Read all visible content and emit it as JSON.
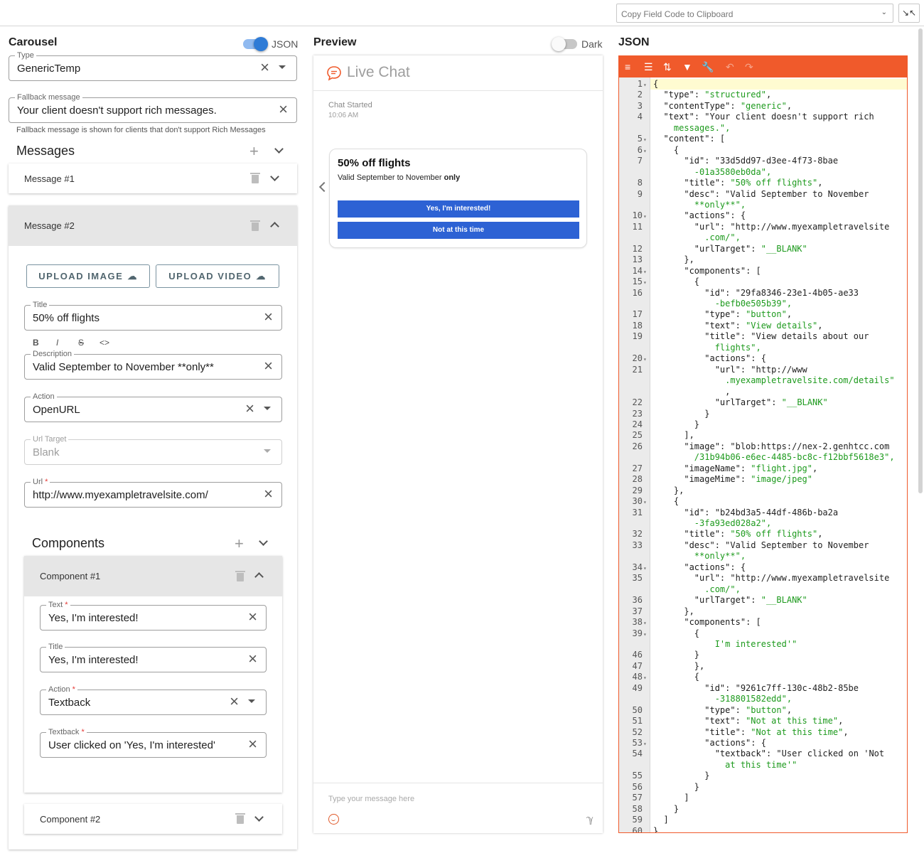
{
  "topbar": {
    "copy_select": "Copy Field Code to Clipboard",
    "shrink_icon": "minimize-icon"
  },
  "carousel": {
    "title": "Carousel",
    "json_toggle_label": "JSON",
    "json_toggle_on": true,
    "type": {
      "label": "Type",
      "value": "GenericTemp"
    },
    "fallback": {
      "label": "Fallback message",
      "value": "Your client doesn't support rich messages.",
      "helper": "Fallback message is shown for clients that don't support Rich Messages"
    },
    "messages_title": "Messages",
    "message1": {
      "label": "Message #1"
    },
    "message2": {
      "label": "Message #2",
      "upload_image": "UPLOAD IMAGE",
      "upload_video": "UPLOAD VIDEO",
      "title": {
        "label": "Title",
        "value": "50% off flights"
      },
      "format_buttons": [
        "B",
        "I",
        "S",
        "<>"
      ],
      "description": {
        "label": "Description",
        "value": "Valid September to November **only**"
      },
      "action": {
        "label": "Action",
        "value": "OpenURL"
      },
      "url_target": {
        "label": "Url Target",
        "value": "Blank"
      },
      "url": {
        "label": "Url",
        "value": "http://www.myexampletravelsite.com/"
      },
      "components_title": "Components",
      "component1": {
        "label": "Component #1",
        "text": {
          "label": "Text",
          "value": "Yes, I'm interested!"
        },
        "title": {
          "label": "Title",
          "value": "Yes, I'm interested!"
        },
        "action": {
          "label": "Action",
          "value": "Textback"
        },
        "textback": {
          "label": "Textback",
          "value": "User clicked on 'Yes, I'm interested'"
        }
      },
      "component2": {
        "label": "Component #2"
      }
    }
  },
  "preview": {
    "title": "Preview",
    "dark_label": "Dark",
    "dark_on": false,
    "chat_title": "Live Chat",
    "chat_started": "Chat Started",
    "chat_time": "10:06 AM",
    "card_title": "50% off flights",
    "card_desc_pre": "Valid September to November ",
    "card_desc_bold": "only",
    "button1": "Yes, I'm interested!",
    "button2": "Not at this time",
    "input_placeholder": "Type your message here"
  },
  "json_editor": {
    "title": "JSON",
    "lines": [
      {
        "n": "1",
        "f": true,
        "c": "{"
      },
      {
        "n": "2",
        "c": "  \"type\": \"structured\","
      },
      {
        "n": "3",
        "c": "  \"contentType\": \"generic\","
      },
      {
        "n": "4",
        "c": "  \"text\": \"Your client doesn't support rich"
      },
      {
        "n": "",
        "c": "    messages.\","
      },
      {
        "n": "5",
        "f": true,
        "c": "  \"content\": ["
      },
      {
        "n": "6",
        "f": true,
        "c": "    {"
      },
      {
        "n": "7",
        "c": "      \"id\": \"33d5dd97-d3ee-4f73-8bae"
      },
      {
        "n": "",
        "c": "        -01a3580eb0da\","
      },
      {
        "n": "8",
        "c": "      \"title\": \"50% off flights\","
      },
      {
        "n": "9",
        "c": "      \"desc\": \"Valid September to November"
      },
      {
        "n": "",
        "c": "        **only**\","
      },
      {
        "n": "10",
        "f": true,
        "c": "      \"actions\": {"
      },
      {
        "n": "11",
        "c": "        \"url\": \"http://www.myexampletravelsite"
      },
      {
        "n": "",
        "c": "          .com/\","
      },
      {
        "n": "12",
        "c": "        \"urlTarget\": \"__BLANK\""
      },
      {
        "n": "13",
        "c": "      },"
      },
      {
        "n": "14",
        "f": true,
        "c": "      \"components\": ["
      },
      {
        "n": "15",
        "f": true,
        "c": "        {"
      },
      {
        "n": "16",
        "c": "          \"id\": \"29fa8346-23e1-4b05-ae33"
      },
      {
        "n": "",
        "c": "            -befb0e505b39\","
      },
      {
        "n": "17",
        "c": "          \"type\": \"button\","
      },
      {
        "n": "18",
        "c": "          \"text\": \"View details\","
      },
      {
        "n": "19",
        "c": "          \"title\": \"View details about our"
      },
      {
        "n": "",
        "c": "            flights\","
      },
      {
        "n": "20",
        "f": true,
        "c": "          \"actions\": {"
      },
      {
        "n": "21",
        "c": "            \"url\": \"http://www"
      },
      {
        "n": "",
        "c": "              .myexampletravelsite.com/details\""
      },
      {
        "n": "",
        "c": "              ,"
      },
      {
        "n": "22",
        "c": "            \"urlTarget\": \"__BLANK\""
      },
      {
        "n": "23",
        "c": "          }"
      },
      {
        "n": "24",
        "c": "        }"
      },
      {
        "n": "25",
        "c": "      ],"
      },
      {
        "n": "26",
        "c": "      \"image\": \"blob:https://nex-2.genhtcc.com"
      },
      {
        "n": "",
        "c": "        /31b94b06-e6ec-4485-bc8c-f12bbf5618e3\","
      },
      {
        "n": "27",
        "c": "      \"imageName\": \"flight.jpg\","
      },
      {
        "n": "28",
        "c": "      \"imageMime\": \"image/jpeg\""
      },
      {
        "n": "29",
        "c": "    },"
      },
      {
        "n": "30",
        "f": true,
        "c": "    {"
      },
      {
        "n": "31",
        "c": "      \"id\": \"b24bd3a5-44df-486b-ba2a"
      },
      {
        "n": "",
        "c": "        -3fa93ed028a2\","
      },
      {
        "n": "32",
        "c": "      \"title\": \"50% off flights\","
      },
      {
        "n": "33",
        "c": "      \"desc\": \"Valid September to November"
      },
      {
        "n": "",
        "c": "        **only**\","
      },
      {
        "n": "34",
        "f": true,
        "c": "      \"actions\": {"
      },
      {
        "n": "35",
        "c": "        \"url\": \"http://www.myexampletravelsite"
      },
      {
        "n": "",
        "c": "          .com/\","
      },
      {
        "n": "36",
        "c": "        \"urlTarget\": \"__BLANK\""
      },
      {
        "n": "37",
        "c": "      },"
      },
      {
        "n": "38",
        "f": true,
        "c": "      \"components\": ["
      },
      {
        "n": "39",
        "f": true,
        "c": "        {"
      },
      {
        "n": "",
        "c": "            I'm interested'\""
      },
      {
        "n": "46",
        "c": "        }"
      },
      {
        "n": "47",
        "c": "        },"
      },
      {
        "n": "48",
        "f": true,
        "c": "        {"
      },
      {
        "n": "49",
        "c": "          \"id\": \"9261c7ff-130c-48b2-85be"
      },
      {
        "n": "",
        "c": "            -318801582edd\","
      },
      {
        "n": "50",
        "c": "          \"type\": \"button\","
      },
      {
        "n": "51",
        "c": "          \"text\": \"Not at this time\","
      },
      {
        "n": "52",
        "c": "          \"title\": \"Not at this time\","
      },
      {
        "n": "53",
        "f": true,
        "c": "          \"actions\": {"
      },
      {
        "n": "54",
        "c": "            \"textback\": \"User clicked on 'Not"
      },
      {
        "n": "",
        "c": "              at this time'\""
      },
      {
        "n": "55",
        "c": "          }"
      },
      {
        "n": "56",
        "c": "        }"
      },
      {
        "n": "57",
        "c": "      ]"
      },
      {
        "n": "58",
        "c": "    }"
      },
      {
        "n": "59",
        "c": "  ]"
      },
      {
        "n": "60",
        "c": "}"
      }
    ]
  },
  "colors": {
    "accent": "#2d62d4",
    "json_orange": "#f05a2b",
    "toggle_blue": "#2e7bd6"
  }
}
